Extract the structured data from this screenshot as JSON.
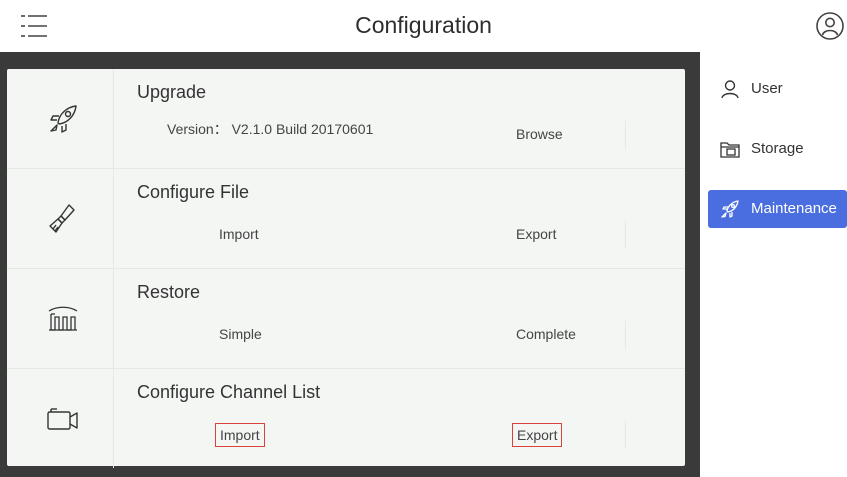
{
  "header": {
    "title": "Configuration",
    "menu_icon": "menu-icon",
    "profile_icon": "user-circle-icon"
  },
  "rows": [
    {
      "icon": "rocket-icon",
      "title": "Upgrade",
      "info": "Version： V2.1.0 Build 20170601",
      "buttons": [
        "Browse"
      ]
    },
    {
      "icon": "brush-icon",
      "title": "Configure File",
      "buttons": [
        "Import",
        "Export"
      ]
    },
    {
      "icon": "restore-icon",
      "title": "Restore",
      "buttons": [
        "Simple",
        "Complete"
      ]
    },
    {
      "icon": "camera-icon",
      "title": "Configure Channel List",
      "buttons": [
        "Import",
        "Export"
      ]
    }
  ],
  "sidebar": {
    "items": [
      {
        "label": "User",
        "icon": "user-icon",
        "active": false
      },
      {
        "label": "Storage",
        "icon": "storage-icon",
        "active": false
      },
      {
        "label": "Maintenance",
        "icon": "rocket-icon",
        "active": true
      }
    ]
  },
  "colors": {
    "accent": "#4a6ee0",
    "highlight_border": "#d9413a",
    "frame": "#3a3a3a",
    "panel": "#f4f6f4"
  }
}
